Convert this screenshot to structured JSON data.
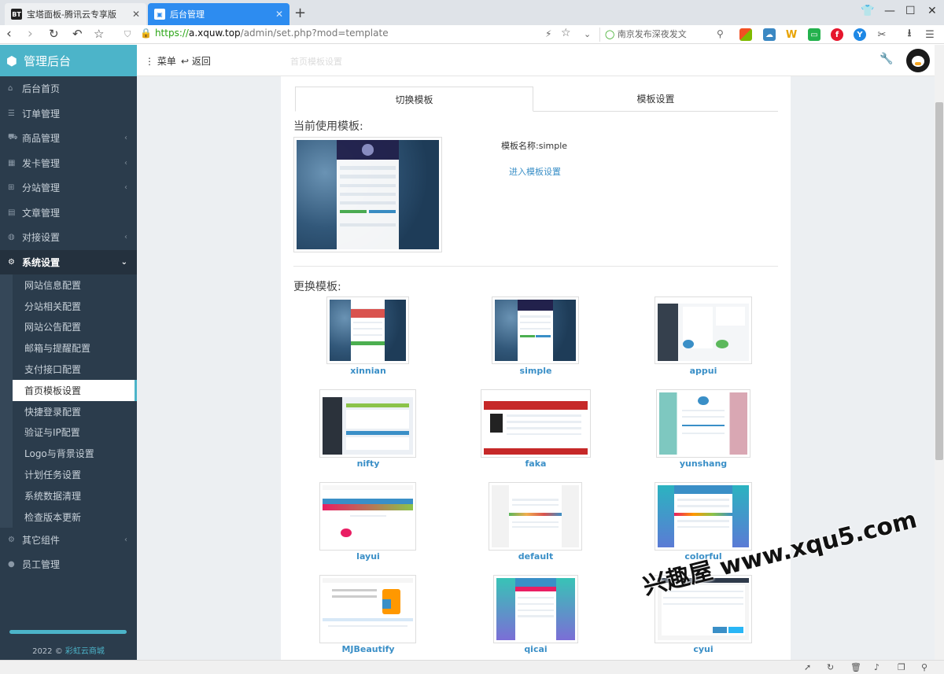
{
  "browser": {
    "tabs": [
      {
        "favicon": "BT",
        "title": "宝塔面板-腾讯云专享版",
        "active": false
      },
      {
        "favicon": "▣",
        "title": "后台管理",
        "active": true
      }
    ],
    "new_tab_icon": "+",
    "window_controls": {
      "skin": "shirt-icon",
      "minimize": "—",
      "maximize": "☐",
      "close": "✕"
    },
    "url": {
      "scheme": "https://",
      "host": "a.xquw.top",
      "path": "/admin/set.php?mod=template"
    },
    "search_text": "南京发布深夜发文",
    "extensions": [
      {
        "name": "windows-icon",
        "color": "#f25022"
      },
      {
        "name": "cloud-icon",
        "color": "#3b88c3"
      },
      {
        "name": "w-icon",
        "label": "W",
        "color": "#e8a300"
      },
      {
        "name": "chat-icon",
        "color": "#23b14d"
      },
      {
        "name": "weibo-icon",
        "color": "#e6162d"
      },
      {
        "name": "y-icon",
        "label": "Y",
        "color": "#1e88e5"
      },
      {
        "name": "scissors-icon",
        "color": "#555555"
      },
      {
        "name": "download-icon",
        "color": "#555555"
      },
      {
        "name": "more-menu-icon",
        "color": "#555555"
      }
    ]
  },
  "app": {
    "brand": "管理后台",
    "menu_label": "菜单",
    "back_label": "返回",
    "page_ghost_title": "首页模板设置",
    "sidebar": {
      "items": [
        {
          "label": "后台首页",
          "icon": "home-icon",
          "arrow": false
        },
        {
          "label": "订单管理",
          "icon": "list-icon",
          "arrow": false
        },
        {
          "label": "商品管理",
          "icon": "cart-icon",
          "arrow": true
        },
        {
          "label": "发卡管理",
          "icon": "grid-icon",
          "arrow": true
        },
        {
          "label": "分站管理",
          "icon": "sitemap-icon",
          "arrow": true
        },
        {
          "label": "文章管理",
          "icon": "book-icon",
          "arrow": false
        },
        {
          "label": "对接设置",
          "icon": "globe-icon",
          "arrow": true
        },
        {
          "label": "系统设置",
          "icon": "cog-icon",
          "arrow": true,
          "open": true
        }
      ],
      "submenu": [
        {
          "label": "网站信息配置"
        },
        {
          "label": "分站相关配置"
        },
        {
          "label": "网站公告配置"
        },
        {
          "label": "邮箱与提醒配置"
        },
        {
          "label": "支付接口配置"
        },
        {
          "label": "首页模板设置",
          "active": true
        },
        {
          "label": "快捷登录配置"
        },
        {
          "label": "验证与IP配置"
        },
        {
          "label": "Logo与背景设置"
        },
        {
          "label": "计划任务设置"
        },
        {
          "label": "系统数据清理"
        },
        {
          "label": "检查版本更新"
        }
      ],
      "tail_items": [
        {
          "label": "其它组件",
          "icon": "cogs-icon",
          "arrow": true
        },
        {
          "label": "员工管理",
          "icon": "user-icon",
          "arrow": false
        }
      ],
      "copyright_year": "2022 ©",
      "copyright_link": "彩虹云商城"
    },
    "panel": {
      "tabs": [
        "切换模板",
        "模板设置"
      ],
      "current_heading": "当前使用模板:",
      "template_name_label": "模板名称:",
      "template_name_value": "simple",
      "enter_settings_link": "进入模板设置",
      "change_heading": "更换模板:",
      "templates": [
        {
          "name": "xinnian",
          "style": "xinnian"
        },
        {
          "name": "simple",
          "style": "simple"
        },
        {
          "name": "appui",
          "style": "appui"
        },
        {
          "name": "nifty",
          "style": "nifty"
        },
        {
          "name": "faka",
          "style": "faka"
        },
        {
          "name": "yunshang",
          "style": "yunshang"
        },
        {
          "name": "layui",
          "style": "layui"
        },
        {
          "name": "default",
          "style": "default"
        },
        {
          "name": "colorful",
          "style": "colorful"
        },
        {
          "name": "MJBeautify",
          "style": "mjb"
        },
        {
          "name": "qicai",
          "style": "qicai"
        },
        {
          "name": "cyui",
          "style": "cyui"
        }
      ]
    }
  },
  "watermark": "兴趣屋 www.xqu5.com",
  "statusbar_icons": [
    "rocket-icon",
    "refresh-icon",
    "trash-icon",
    "volume-icon",
    "window-icon",
    "zoom-icon"
  ]
}
